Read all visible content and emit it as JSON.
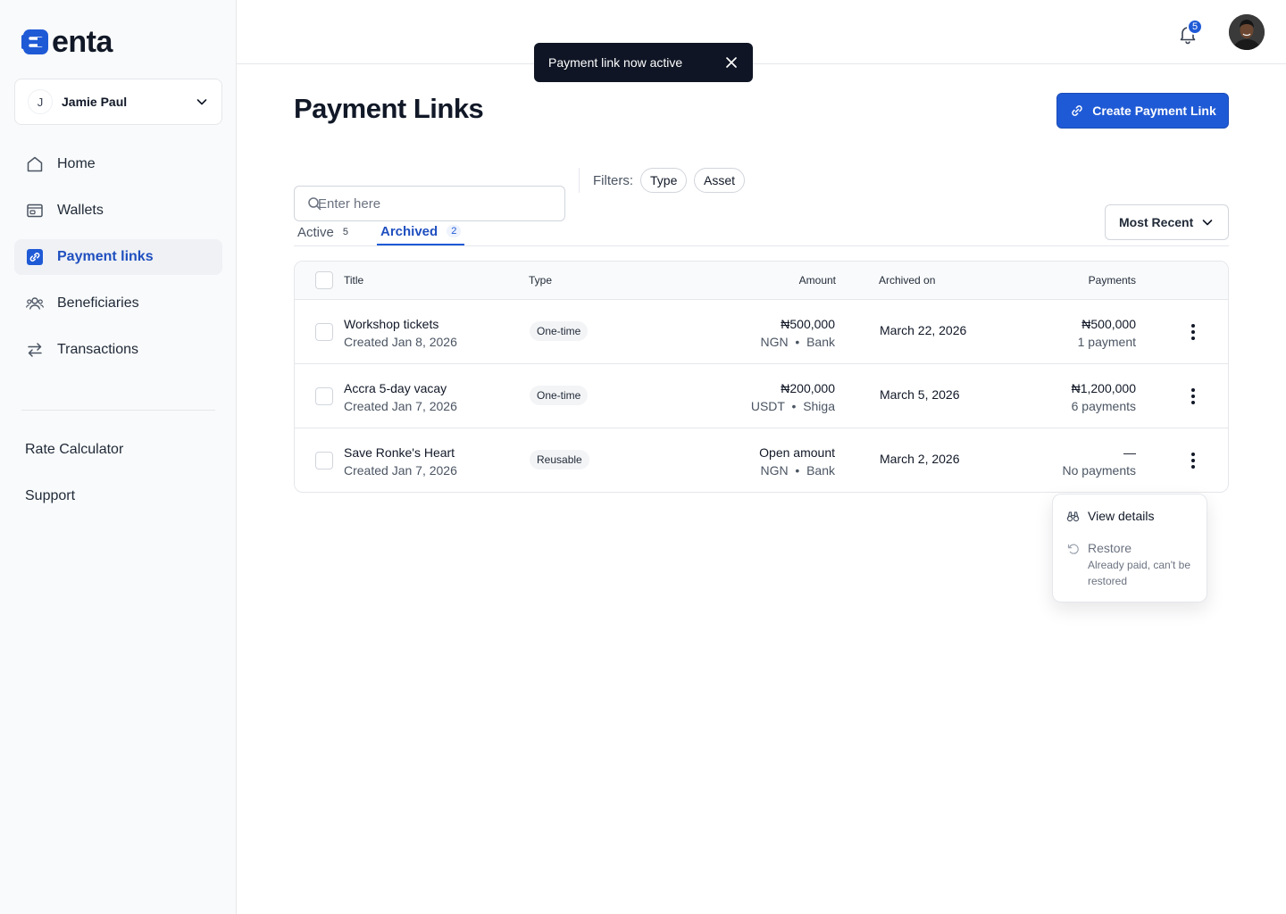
{
  "brand": {
    "name": "enta",
    "color": "#1f5ad6"
  },
  "account": {
    "initial": "J",
    "name": "Jamie Paul"
  },
  "nav": [
    {
      "label": "Home",
      "icon": "home-icon"
    },
    {
      "label": "Wallets",
      "icon": "wallet-icon"
    },
    {
      "label": "Payment links",
      "icon": "link-icon",
      "active": true
    },
    {
      "label": "Beneficiaries",
      "icon": "users-icon"
    },
    {
      "label": "Transactions",
      "icon": "transfer-arrows-icon"
    }
  ],
  "secondary_nav": [
    "Rate Calculator",
    "Support"
  ],
  "topbar": {
    "notification_count": "5"
  },
  "toast": {
    "message": "Payment link now active"
  },
  "page": {
    "title": "Payment Links",
    "create_label": "Create Payment Link"
  },
  "search": {
    "placeholder": "Enter here"
  },
  "filters": {
    "label": "Filters:",
    "chips": [
      "Type",
      "Asset"
    ]
  },
  "tabs": [
    {
      "label": "Active",
      "count": "5"
    },
    {
      "label": "Archived",
      "count": "2",
      "active": true
    }
  ],
  "sort": {
    "label": "Most Recent"
  },
  "table": {
    "headers": {
      "title": "Title",
      "type": "Type",
      "amount": "Amount",
      "archived_on": "Archived on",
      "payments": "Payments"
    },
    "rows": [
      {
        "title": "Workshop tickets",
        "created": "Created Jan 8, 2026",
        "type": "One-time",
        "amount": "₦500,000",
        "currency": "NGN",
        "method": "Bank",
        "archived_on": "March 22, 2026",
        "payments_total": "₦500,000",
        "payments_count": "1 payment"
      },
      {
        "title": "Accra 5-day vacay",
        "created": "Created Jan 7, 2026",
        "type": "One-time",
        "amount": "₦200,000",
        "currency": "USDT",
        "method": "Shiga",
        "archived_on": "March 5, 2026",
        "payments_total": "₦1,200,000",
        "payments_count": "6 payments"
      },
      {
        "title": "Save Ronke's Heart",
        "created": "Created Jan 7, 2026",
        "type": "Reusable",
        "amount": "Open amount",
        "currency": "NGN",
        "method": "Bank",
        "archived_on": "March 2, 2026",
        "payments_total": "—",
        "payments_count": "No payments"
      }
    ]
  },
  "row_menu": {
    "view_details": "View details",
    "restore": "Restore",
    "restore_note": "Already paid, can't be restored"
  }
}
